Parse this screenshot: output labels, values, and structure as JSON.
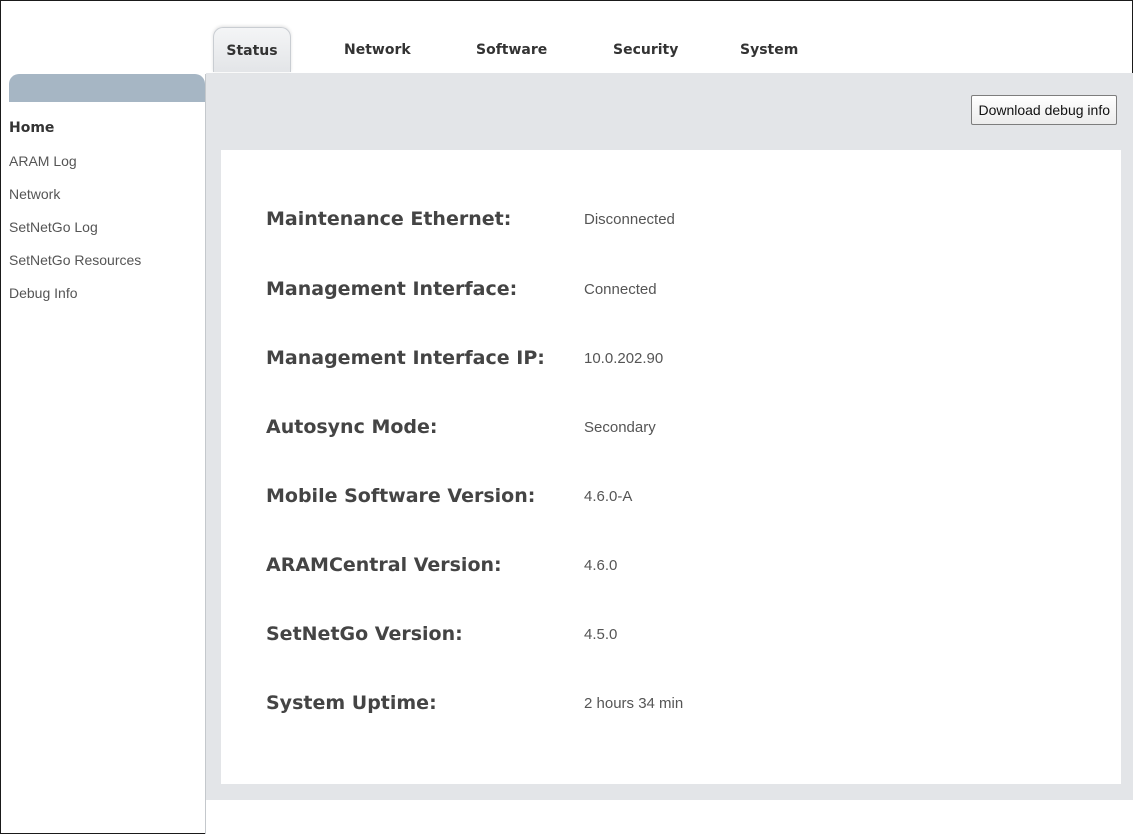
{
  "tabs": {
    "status": "Status",
    "network": "Network",
    "software": "Software",
    "security": "Security",
    "system": "System",
    "active": "Status"
  },
  "sidebar": {
    "items": [
      {
        "label": "Home",
        "active": true
      },
      {
        "label": "ARAM Log",
        "active": false
      },
      {
        "label": "Network",
        "active": false
      },
      {
        "label": "SetNetGo Log",
        "active": false
      },
      {
        "label": "SetNetGo Resources",
        "active": false
      },
      {
        "label": "Debug Info",
        "active": false
      }
    ]
  },
  "toolbar": {
    "download_label": "Download debug info"
  },
  "status": {
    "rows": [
      {
        "label": "Maintenance Ethernet:",
        "value": "Disconnected"
      },
      {
        "label": "Management Interface:",
        "value": "Connected"
      },
      {
        "label": "Management Interface IP:",
        "value": "10.0.202.90"
      },
      {
        "label": "Autosync Mode:",
        "value": "Secondary"
      },
      {
        "label": "Mobile Software Version:",
        "value": "4.6.0-A"
      },
      {
        "label": "ARAMCentral Version:",
        "value": "4.6.0"
      },
      {
        "label": "SetNetGo Version:",
        "value": "4.5.0"
      },
      {
        "label": "System Uptime:",
        "value": "2 hours 34 min"
      }
    ]
  },
  "colors": {
    "sidebar_header": "#a6b6c4",
    "panel_background": "#e3e5e8",
    "card_background": "#ffffff",
    "label_text": "#444444",
    "value_text": "#555555"
  }
}
